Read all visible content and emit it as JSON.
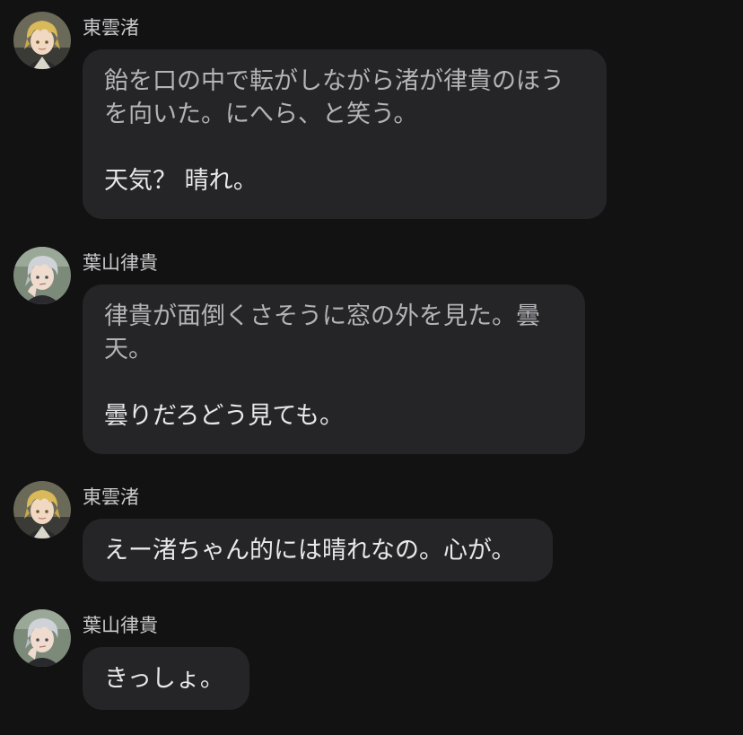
{
  "colors": {
    "background": "#121212",
    "bubble": "#252528",
    "name_text": "#c9c9cc",
    "narration_text": "#b4b4b8",
    "speech_text": "#e8e8ea"
  },
  "messages": [
    {
      "sender": "東雲渚",
      "avatar": "nagisa-avatar",
      "narration": [
        "飴を口の中で転がしながら渚が律貴のほう",
        "を向いた。にへら、と笑う。"
      ],
      "speech": "天気？ 晴れ。"
    },
    {
      "sender": "葉山律貴",
      "avatar": "ritsuki-avatar",
      "narration": [
        "律貴が面倒くさそうに窓の外を見た。曇",
        "天。"
      ],
      "speech": "曇りだろどう見ても。"
    },
    {
      "sender": "東雲渚",
      "avatar": "nagisa-avatar",
      "speech": "えー渚ちゃん的には晴れなの。心が。"
    },
    {
      "sender": "葉山律貴",
      "avatar": "ritsuki-avatar",
      "speech": "きっしょ。"
    }
  ]
}
